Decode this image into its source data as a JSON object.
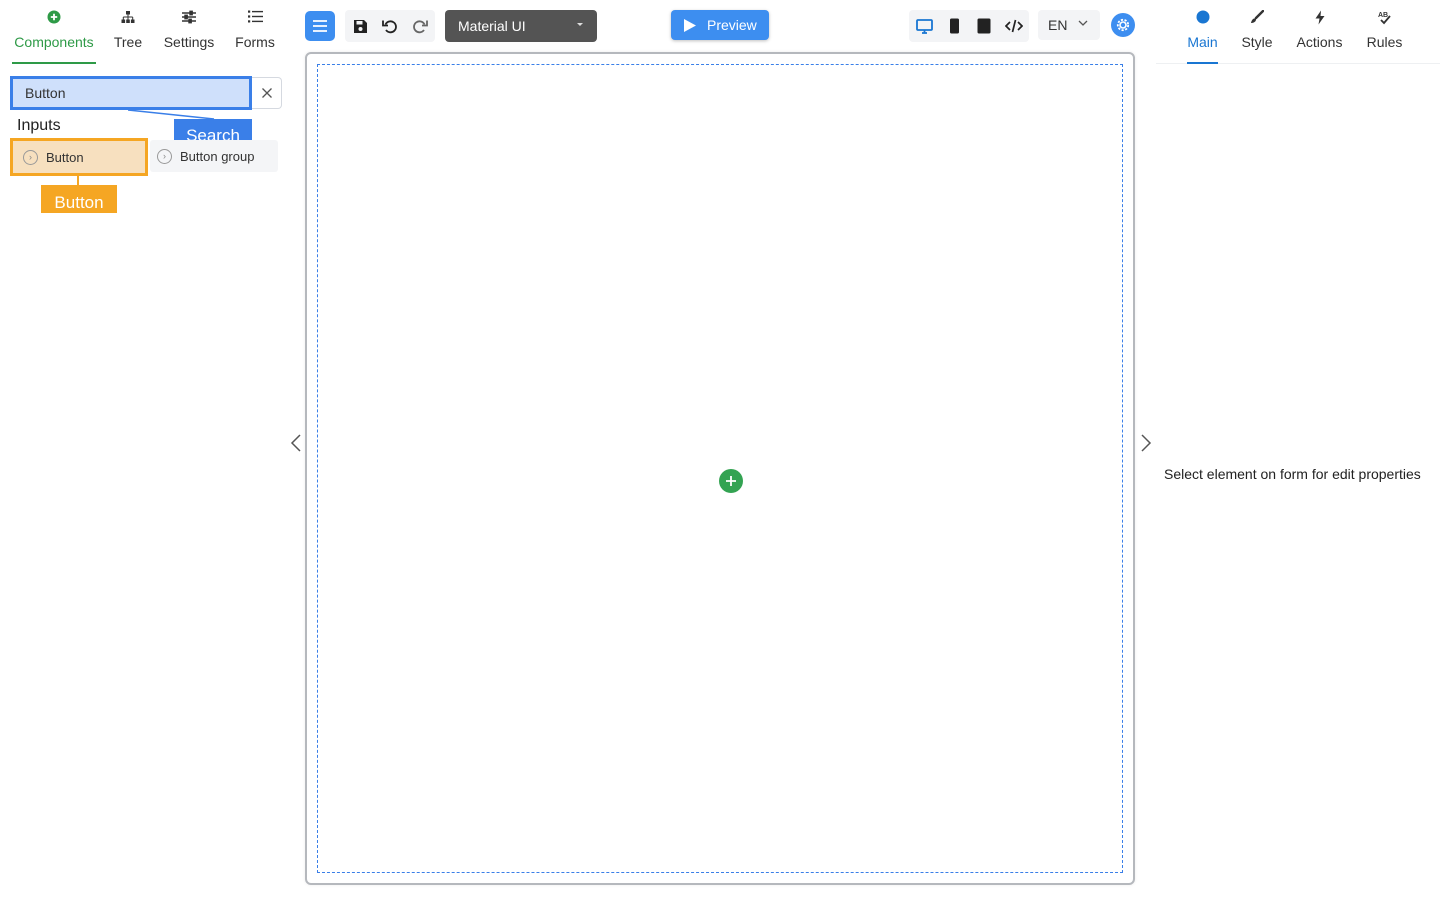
{
  "left_tabs": [
    {
      "label": "Components",
      "icon": "plus-circle-icon",
      "active": true
    },
    {
      "label": "Tree",
      "icon": "tree-icon",
      "active": false
    },
    {
      "label": "Settings",
      "icon": "sliders-icon",
      "active": false
    },
    {
      "label": "Forms",
      "icon": "list-icon",
      "active": false
    }
  ],
  "search": {
    "value": "Button",
    "callout": "Search"
  },
  "palette": {
    "group_title": "Inputs",
    "items": [
      {
        "label": "Button",
        "icon": "component-icon",
        "highlighted": true
      },
      {
        "label": "Button group",
        "icon": "component-icon",
        "highlighted": false
      }
    ],
    "highlight_callout": "Button"
  },
  "toolbar": {
    "theme_select": "Material UI",
    "preview_label": "Preview",
    "language": "EN",
    "icons": [
      "menu-icon",
      "save-icon",
      "undo-icon",
      "redo-icon",
      "desktop-icon",
      "tablet-icon",
      "phone-icon",
      "code-icon",
      "settings-gear-icon"
    ]
  },
  "right_tabs": [
    {
      "label": "Main",
      "icon": "circle-icon",
      "active": true
    },
    {
      "label": "Style",
      "icon": "brush-icon",
      "active": false
    },
    {
      "label": "Actions",
      "icon": "lightning-icon",
      "active": false
    },
    {
      "label": "Rules",
      "icon": "rules-icon",
      "active": false
    }
  ],
  "properties": {
    "empty_message": "Select element on form for edit properties"
  },
  "colors": {
    "primary_blue": "#3d8ef0",
    "green": "#2e9a47",
    "add_button_green": "#33a352",
    "highlight_orange": "#f5a623",
    "selection_blue": "#3a7fe8",
    "theme_select_bg": "#545454",
    "right_tab_active": "#1976d2"
  }
}
